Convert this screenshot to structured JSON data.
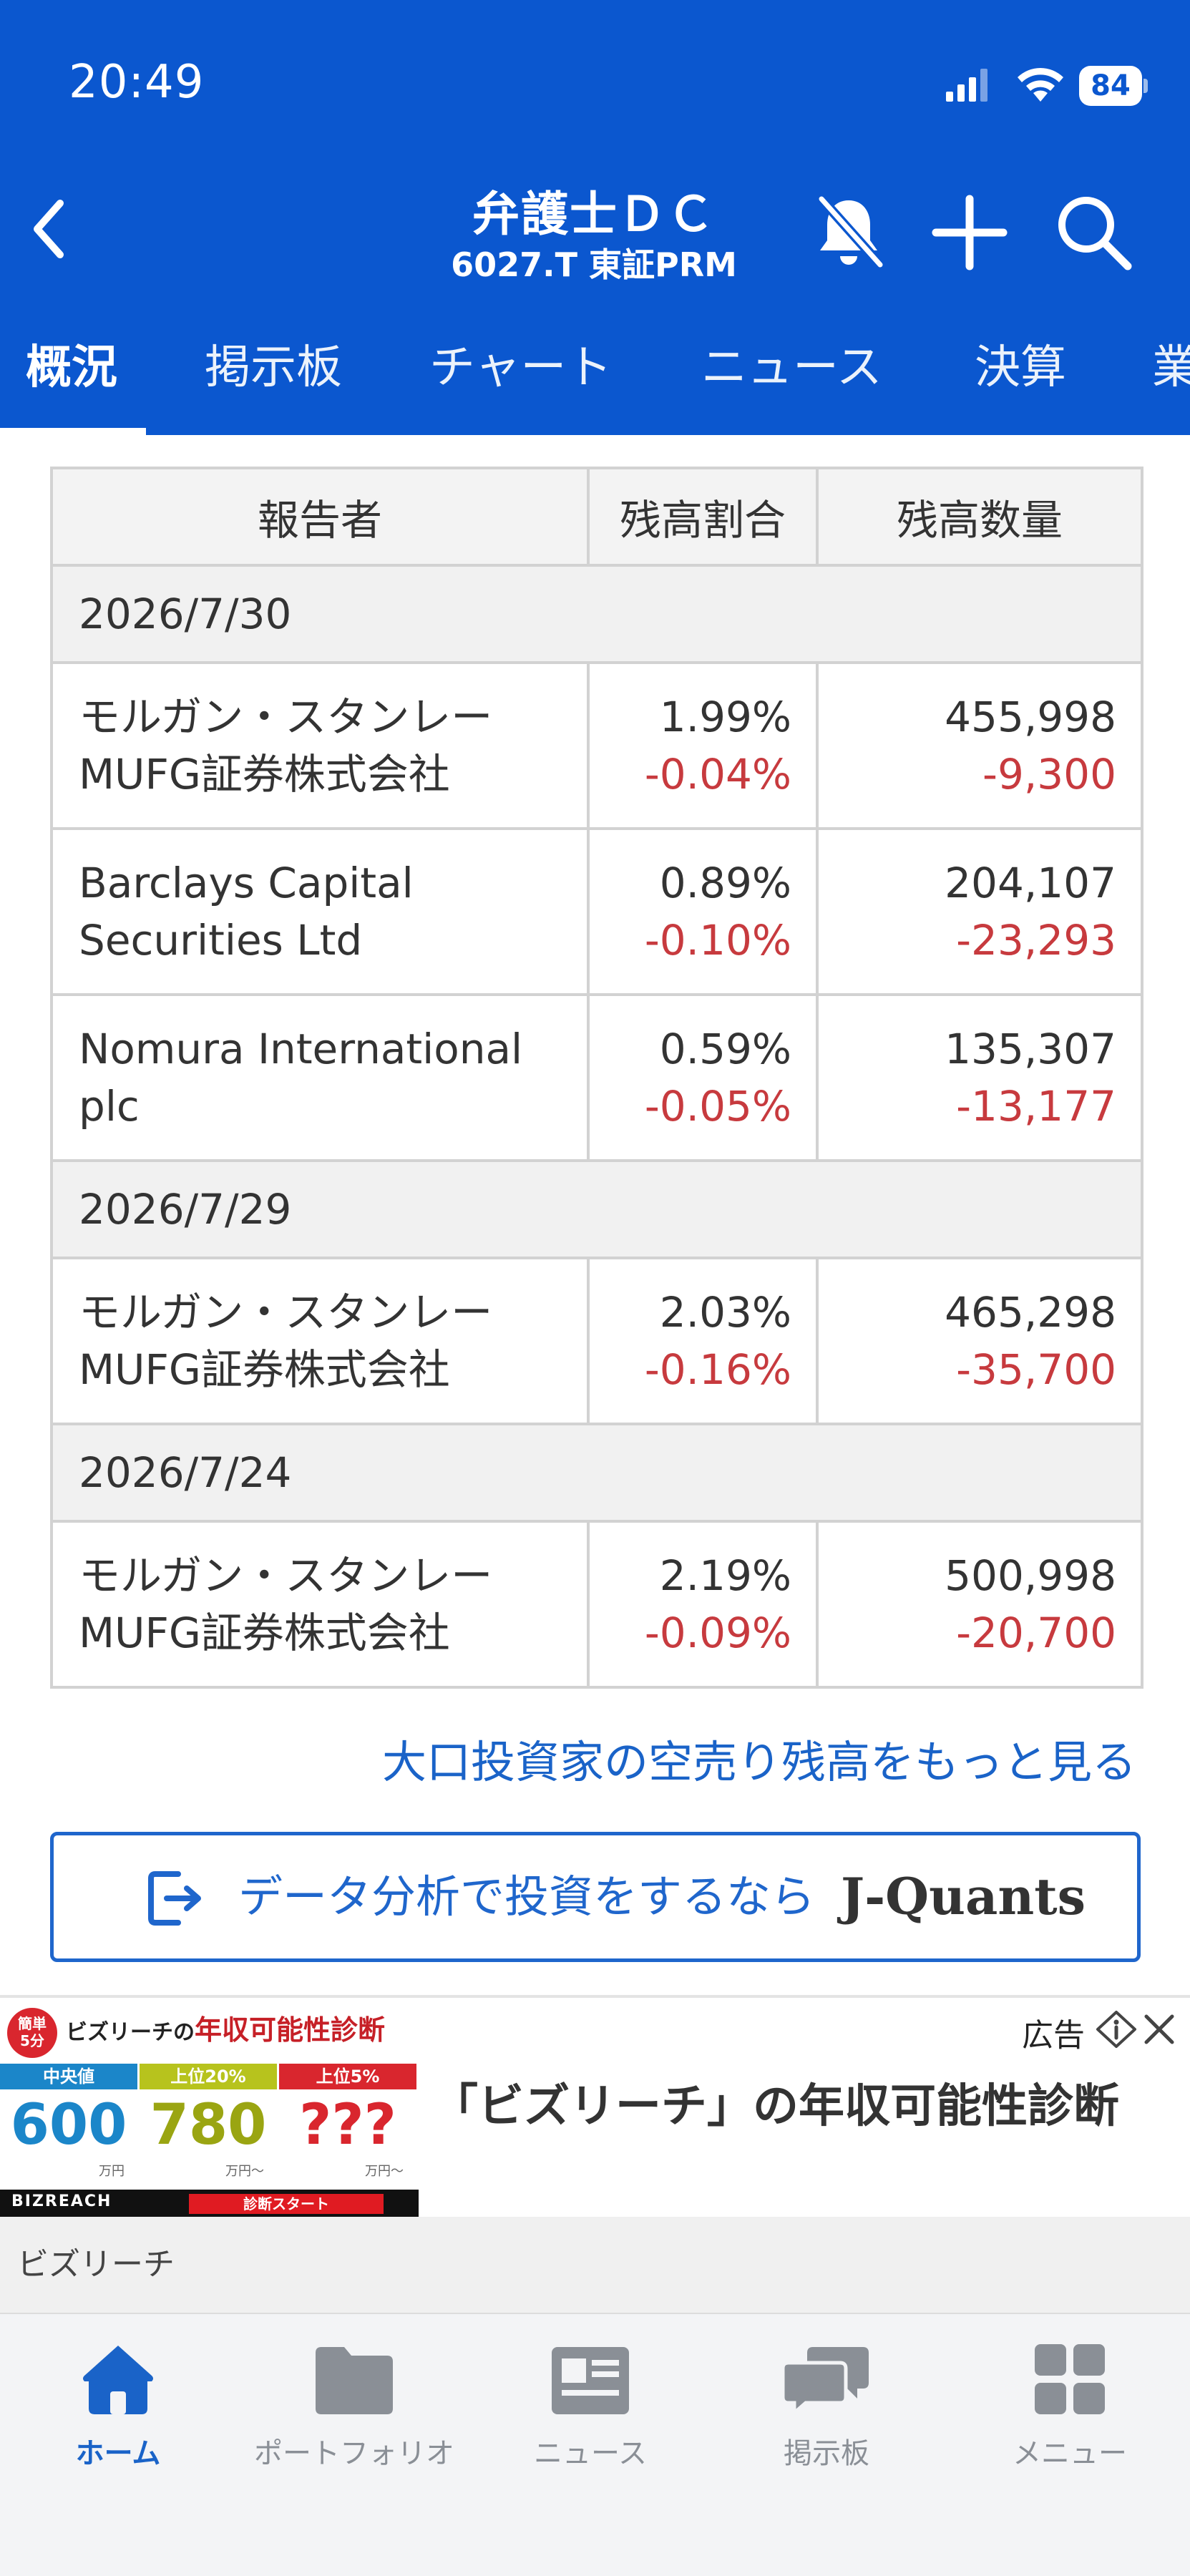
{
  "status_bar": {
    "time": "20:49",
    "battery": "84"
  },
  "header": {
    "title": "弁護士ＤＣ",
    "subtitle": "6027.T 東証PRM",
    "tabs": [
      {
        "label": "概況",
        "active": true
      },
      {
        "label": "掲示板"
      },
      {
        "label": "チャート"
      },
      {
        "label": "ニュース"
      },
      {
        "label": "決算"
      },
      {
        "label": "業"
      }
    ]
  },
  "table": {
    "headers": [
      "報告者",
      "残高割合",
      "残高数量"
    ],
    "groups": [
      {
        "date": "2026/7/30",
        "rows": [
          {
            "name_line1": "モルガン・スタンレー",
            "name_line2": "MUFG証券株式会社",
            "ratio": "1.99%",
            "ratio_change": "-0.04%",
            "qty": "455,998",
            "qty_change": "-9,300"
          },
          {
            "name_line1": "Barclays Capital",
            "name_line2": "Securities Ltd",
            "ratio": "0.89%",
            "ratio_change": "-0.10%",
            "qty": "204,107",
            "qty_change": "-23,293"
          },
          {
            "name_line1": "Nomura International",
            "name_line2": "plc",
            "ratio": "0.59%",
            "ratio_change": "-0.05%",
            "qty": "135,307",
            "qty_change": "-13,177"
          }
        ]
      },
      {
        "date": "2026/7/29",
        "rows": [
          {
            "name_line1": "モルガン・スタンレー",
            "name_line2": "MUFG証券株式会社",
            "ratio": "2.03%",
            "ratio_change": "-0.16%",
            "qty": "465,298",
            "qty_change": "-35,700"
          }
        ]
      },
      {
        "date": "2026/7/24",
        "rows": [
          {
            "name_line1": "モルガン・スタンレー",
            "name_line2": "MUFG証券株式会社",
            "ratio": "2.19%",
            "ratio_change": "-0.09%",
            "qty": "500,998",
            "qty_change": "-20,700"
          }
        ]
      }
    ]
  },
  "more_link": "大口投資家の空売り残高をもっと見る",
  "jquants": {
    "label": "データ分析で投資をするなら",
    "logo_j": "J",
    "logo_rest": "-Quants"
  },
  "ad": {
    "label": "広告",
    "headline": "「ビズリーチ」の年収可能性診断",
    "sponsor": "ビズリーチ",
    "image": {
      "badge_line1": "簡単",
      "badge_line2": "5分",
      "title_prefix": "ビズリーチの",
      "title_highlight": "年収可能性診断",
      "columns": [
        {
          "head": "中央値",
          "value": "600",
          "unit": "万円",
          "color": "#1b86c9"
        },
        {
          "head": "上位20%",
          "value": "780",
          "unit": "万円〜",
          "color": "#b7c31d"
        },
        {
          "head": "上位5%",
          "value": "???",
          "unit": "万円〜",
          "color": "#d9262e"
        }
      ],
      "footer_logo": "BIZREACH",
      "footer_cta": "診断スタート"
    }
  },
  "bottom_nav": [
    {
      "label": "ホーム",
      "icon": "home-icon",
      "active": true
    },
    {
      "label": "ポートフォリオ",
      "icon": "folder-icon"
    },
    {
      "label": "ニュース",
      "icon": "news-icon"
    },
    {
      "label": "掲示板",
      "icon": "chat-icon"
    },
    {
      "label": "メニュー",
      "icon": "grid-menu-icon"
    }
  ],
  "colors": {
    "header_blue": "#0b57cf",
    "negative_red": "#c73a3e",
    "link_blue": "#1a63c8"
  }
}
